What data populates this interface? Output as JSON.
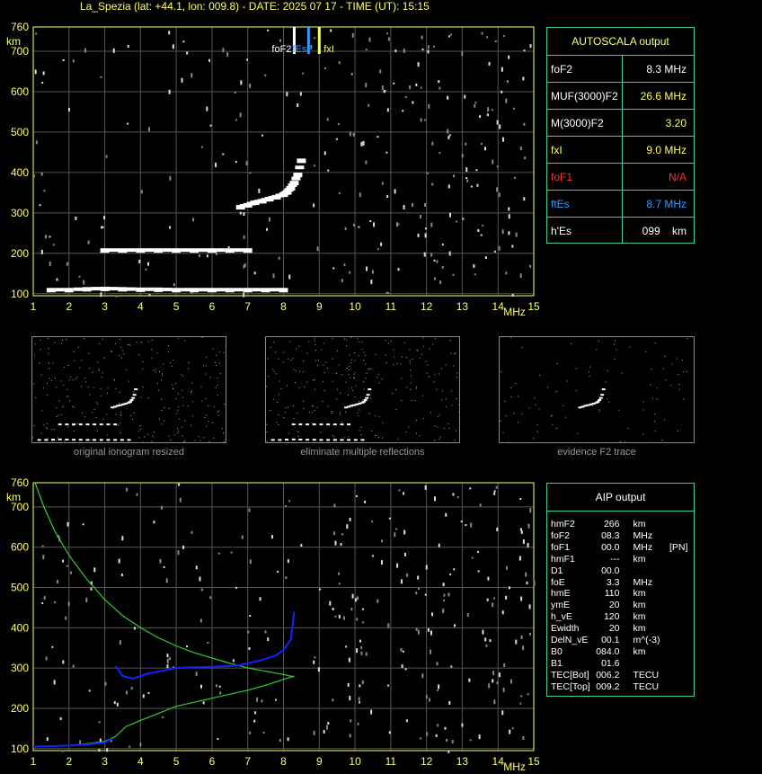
{
  "header": {
    "title": "La_Spezia (lat: +44.1, lon: 009.8) - DATE: 2025 07 17 - TIME (UT): 15:15"
  },
  "axis": {
    "y_unit": "km",
    "x_unit": "MHz",
    "y_ticks": [
      "760",
      "700",
      "600",
      "500",
      "400",
      "300",
      "200",
      "100"
    ],
    "x_ticks": [
      "1",
      "2",
      "3",
      "4",
      "5",
      "6",
      "7",
      "8",
      "9",
      "10",
      "11",
      "12",
      "13",
      "14",
      "15"
    ]
  },
  "markers": {
    "foF2_label": "foF2",
    "fEs_label": "fEs",
    "fxI_label": "fxI"
  },
  "autoscala": {
    "title": "AUTOSCALA output",
    "rows": [
      {
        "key": "foF2",
        "value": "8.3 MHz",
        "key_color": "#ffffff",
        "val_color": "#ffffff"
      },
      {
        "key": "MUF(3000)F2",
        "value": "26.6 MHz",
        "key_color": "#ffffff",
        "val_color": "#ffff66"
      },
      {
        "key": "M(3000)F2",
        "value": "3.20",
        "key_color": "#ffffff",
        "val_color": "#ffff66"
      },
      {
        "key": "fxI",
        "value": "9.0 MHz",
        "key_color": "#ffff66",
        "val_color": "#ffff66"
      },
      {
        "key": "foF1",
        "value": "N/A",
        "key_color": "#ff3333",
        "val_color": "#ff3333"
      },
      {
        "key": "ftEs",
        "value": "8.7 MHz",
        "key_color": "#3399ff",
        "val_color": "#3399ff"
      },
      {
        "key": "h'Es",
        "value": "099    km",
        "key_color": "#ffffff",
        "val_color": "#ffffff"
      }
    ]
  },
  "thumbnails": [
    {
      "caption": "original ionogram resized"
    },
    {
      "caption": "eliminate multiple reflections"
    },
    {
      "caption": "evidence F2 trace"
    }
  ],
  "aip": {
    "title": "AIP output",
    "rows": [
      {
        "k": "hmF2",
        "v": "266",
        "u": "km",
        "x": ""
      },
      {
        "k": "foF2",
        "v": "08.3",
        "u": "MHz",
        "x": ""
      },
      {
        "k": "foF1",
        "v": "00.0",
        "u": "MHz",
        "x": "[PN]"
      },
      {
        "k": "hmF1",
        "v": "---",
        "u": "km",
        "x": ""
      },
      {
        "k": "D1",
        "v": "00.0",
        "u": "",
        "x": ""
      },
      {
        "k": "foE",
        "v": "3.3",
        "u": "MHz",
        "x": ""
      },
      {
        "k": "hmE",
        "v": "110",
        "u": "km",
        "x": ""
      },
      {
        "k": "ymE",
        "v": "20",
        "u": "km",
        "x": ""
      },
      {
        "k": "h_vE",
        "v": "120",
        "u": "km",
        "x": ""
      },
      {
        "k": "Ewidth",
        "v": "20",
        "u": "km",
        "x": ""
      },
      {
        "k": "DelN_vE",
        "v": "00.1",
        "u": "m^(-3)",
        "x": ""
      },
      {
        "k": "B0",
        "v": "084.0",
        "u": "km",
        "x": ""
      },
      {
        "k": "B1",
        "v": "01.6",
        "u": "",
        "x": ""
      },
      {
        "k": "TEC[Bot]",
        "v": "006.2",
        "u": "TECU",
        "x": ""
      },
      {
        "k": "TEC[Top]",
        "v": "009.2",
        "u": "TECU",
        "x": ""
      }
    ]
  },
  "chart_data": [
    {
      "type": "scatter",
      "title": "",
      "xlabel": "MHz",
      "ylabel": "km",
      "xlim": [
        1,
        15
      ],
      "ylim": [
        95,
        760
      ],
      "grid": true,
      "series": [
        {
          "name": "foF2",
          "x": [
            8.3
          ],
          "y": [
            760
          ],
          "color": "#ffffff"
        },
        {
          "name": "fEs",
          "x": [
            8.7
          ],
          "y": [
            760
          ],
          "color": "#3399ff"
        },
        {
          "name": "fxI",
          "x": [
            9.0
          ],
          "y": [
            760
          ],
          "color": "#ffff66"
        },
        {
          "x": [
            6.8,
            7.0,
            7.2,
            7.4,
            7.6,
            7.8,
            8.0,
            8.1,
            8.2,
            8.3,
            8.4,
            8.5
          ],
          "y": [
            315,
            320,
            326,
            330,
            335,
            340,
            346,
            352,
            362,
            375,
            395,
            430
          ],
          "color": "#ffffff"
        },
        {
          "x": [
            1.5,
            2.0,
            2.5,
            3.0,
            3.5,
            4.0,
            4.5,
            5.0,
            5.5,
            6.0,
            6.5,
            7.0,
            7.5,
            8.0
          ],
          "y": [
            110,
            110,
            112,
            113,
            112,
            111,
            111,
            110,
            110,
            110,
            110,
            110,
            110,
            110
          ],
          "color": "#ffffff"
        },
        {
          "x": [
            3.0,
            3.5,
            4.0,
            4.5,
            5.0,
            5.5,
            6.0,
            6.5,
            7.0
          ],
          "y": [
            208,
            208,
            208,
            208,
            208,
            208,
            208,
            208,
            208
          ],
          "color": "#ffffff"
        }
      ]
    },
    {
      "type": "line",
      "title": "",
      "xlabel": "MHz",
      "ylabel": "km",
      "xlim": [
        1,
        15
      ],
      "ylim": [
        95,
        760
      ],
      "grid": true,
      "series": [
        {
          "x": [
            1.05,
            1.3,
            1.6,
            2.0,
            2.5,
            3.0,
            3.5,
            4.0,
            4.5,
            5.0,
            5.5,
            6.0,
            6.5,
            7.0,
            7.5,
            8.0,
            8.3
          ],
          "y": [
            760,
            700,
            640,
            580,
            520,
            470,
            430,
            400,
            375,
            355,
            338,
            325,
            312,
            300,
            292,
            284,
            278
          ],
          "color": "#33cc33"
        },
        {
          "x": [
            1.0,
            2.0,
            2.5,
            3.0,
            3.3,
            3.6,
            4.0,
            5.0,
            6.0,
            7.0,
            7.6,
            8.0,
            8.3
          ],
          "y": [
            105,
            108,
            112,
            118,
            130,
            155,
            170,
            205,
            225,
            245,
            260,
            272,
            280
          ],
          "color": "#33cc33"
        },
        {
          "x": [
            3.3,
            3.5,
            3.8,
            4.2,
            4.6,
            5.0,
            5.5,
            6.0,
            6.5,
            6.8,
            7.0,
            7.4,
            7.8,
            8.0,
            8.2,
            8.3
          ],
          "y": [
            305,
            280,
            274,
            286,
            293,
            300,
            302,
            303,
            305,
            308,
            312,
            320,
            332,
            345,
            370,
            440
          ],
          "color": "#1122ff"
        },
        {
          "x": [
            1.0,
            1.5,
            2.0,
            2.5,
            3.0,
            3.2
          ],
          "y": [
            105,
            106,
            108,
            110,
            115,
            125
          ],
          "color": "#1122ff"
        }
      ]
    }
  ]
}
